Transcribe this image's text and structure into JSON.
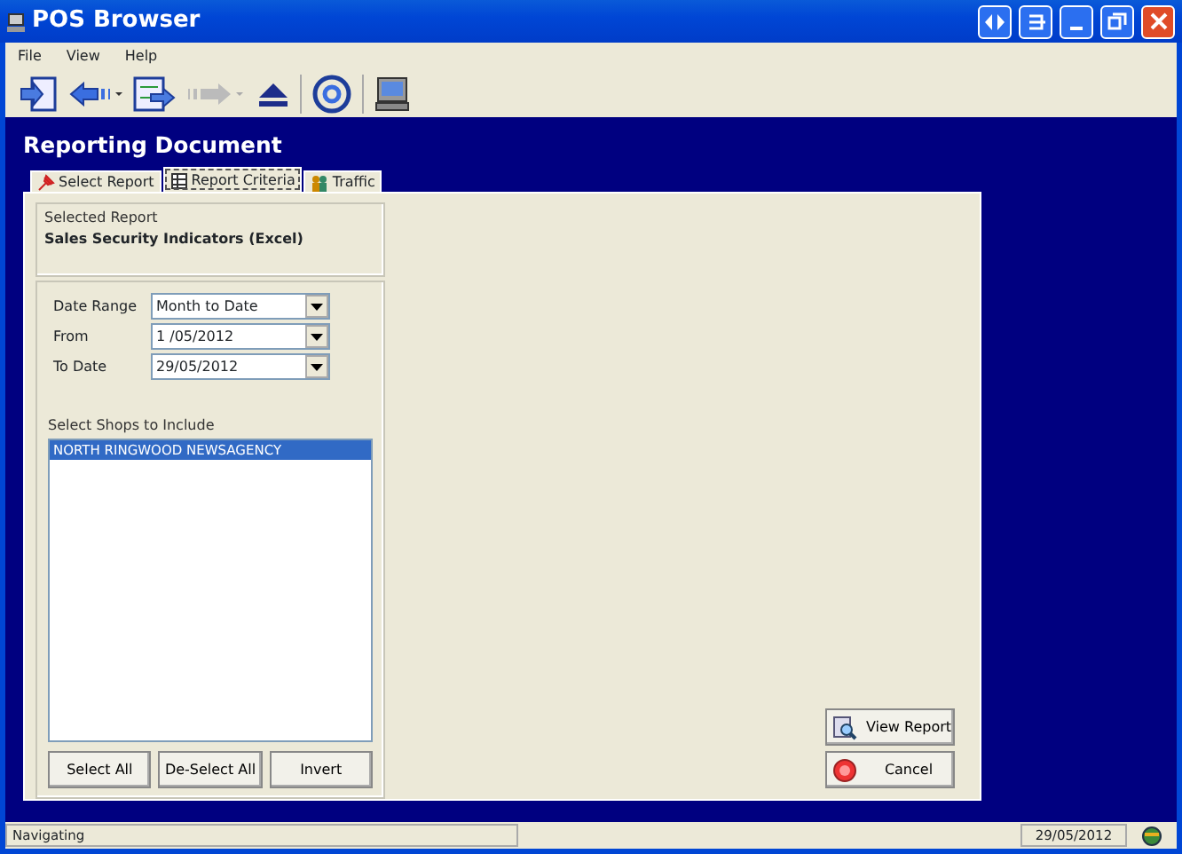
{
  "window": {
    "title": "POS Browser"
  },
  "menu": [
    "File",
    "View",
    "Help"
  ],
  "heading": "Reporting Document",
  "tabs": [
    {
      "label": "Select Report",
      "selected": false
    },
    {
      "label": "Report Criteria",
      "selected": true
    },
    {
      "label": "Traffic",
      "selected": false
    }
  ],
  "selected_report": {
    "caption": "Selected Report",
    "name": "Sales Security Indicators (Excel)"
  },
  "criteria": [
    {
      "label": "Date Range",
      "value": "Month to Date"
    },
    {
      "label": "From",
      "value": "1 /05/2012"
    },
    {
      "label": "To Date",
      "value": "29/05/2012"
    }
  ],
  "shops": {
    "caption": "Select Shops to Include",
    "items": [
      {
        "label": "NORTH RINGWOOD NEWSAGENCY",
        "selected": true
      }
    ]
  },
  "list_buttons": [
    "Select All",
    "De-Select All",
    "Invert"
  ],
  "actions": [
    "View Report",
    "Cancel"
  ],
  "status_bar": {
    "message": "Navigating",
    "date": "29/05/2012"
  }
}
